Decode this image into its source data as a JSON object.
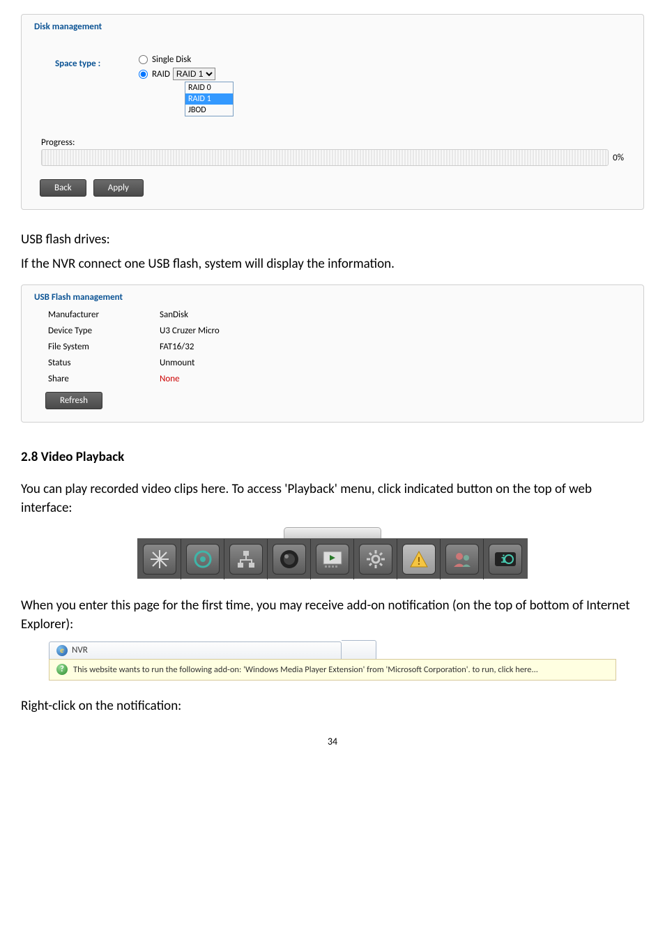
{
  "disk": {
    "legend": "Disk management",
    "space_type_label": "Space type :",
    "single_disk_label": "Single Disk",
    "raid_label": "RAID",
    "raid_selected": "RAID 1",
    "raid_options": [
      "RAID 0",
      "RAID 1",
      "JBOD"
    ],
    "progress_label": "Progress:",
    "progress_pct": "0%",
    "back_btn": "Back",
    "apply_btn": "Apply"
  },
  "text": {
    "usb_heading": "USB flash drives:",
    "usb_desc": "If the NVR connect one USB flash, system will display the information.",
    "section_heading": "2.8 Video Playback",
    "playback_desc": "You can play recorded video clips here. To access 'Playback' menu, click indicated button on the top of web interface:",
    "addon_desc": "When you enter this page for the first time, you may receive add-on notification (on the top of bottom of Internet Explorer):",
    "rightclick": "Right-click on the notification:",
    "page_num": "34"
  },
  "usb": {
    "legend": "USB Flash management",
    "rows": {
      "manufacturer_label": "Manufacturer",
      "manufacturer_val": "SanDisk",
      "devicetype_label": "Device Type",
      "devicetype_val": "U3 Cruzer Micro",
      "filesystem_label": "File System",
      "filesystem_val": "FAT16/32",
      "status_label": "Status",
      "status_val": "Unmount",
      "share_label": "Share",
      "share_val": "None"
    },
    "refresh_btn": "Refresh"
  },
  "toolbar_icons": [
    "snowflake-icon",
    "record-circle-icon",
    "network-icon",
    "lens-icon",
    "screen-play-icon",
    "gear-icon",
    "warning-triangle-icon",
    "users-icon",
    "io-icon"
  ],
  "ie": {
    "tab_title": "NVR",
    "info_text": "This website wants to run the following add-on: 'Windows Media Player Extension' from 'Microsoft Corporation'. to run, click here..."
  }
}
